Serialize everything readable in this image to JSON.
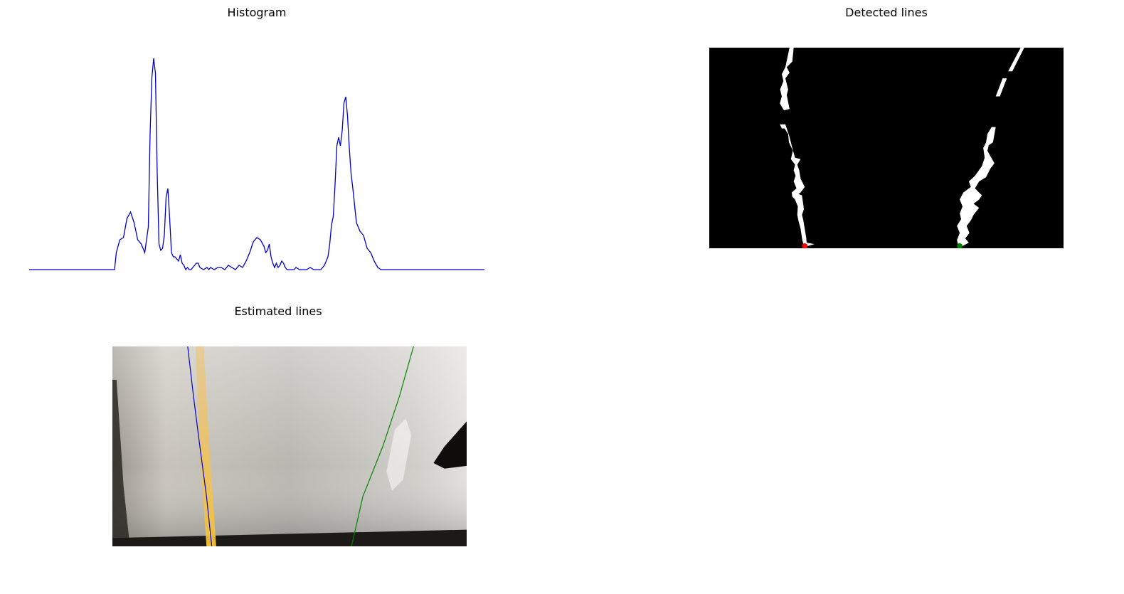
{
  "titles": {
    "histogram": "Histogram",
    "detected": "Detected lines",
    "estimated": "Estimated lines"
  },
  "colors": {
    "histogram_line": "#0000cc",
    "left_line": "#0000cc",
    "right_line": "#008000",
    "left_base_marker": "#ff0000",
    "right_base_marker": "#008000",
    "lane_pixels": "#ffffff",
    "detected_background": "#000000"
  },
  "chart_data": [
    {
      "type": "line",
      "title": "Histogram",
      "axes_visible": false,
      "xlim": [
        0,
        1280
      ],
      "ylim": [
        0,
        100
      ],
      "x": [
        0,
        240,
        245,
        255,
        265,
        275,
        285,
        295,
        305,
        315,
        325,
        335,
        340,
        345,
        350,
        355,
        360,
        365,
        370,
        375,
        380,
        385,
        390,
        395,
        400,
        405,
        410,
        420,
        425,
        430,
        435,
        440,
        445,
        450,
        455,
        460,
        465,
        470,
        475,
        480,
        490,
        500,
        505,
        510,
        520,
        530,
        540,
        550,
        560,
        570,
        580,
        590,
        600,
        610,
        620,
        630,
        640,
        650,
        660,
        665,
        670,
        675,
        680,
        685,
        690,
        695,
        700,
        705,
        710,
        715,
        720,
        725,
        730,
        735,
        740,
        745,
        750,
        760,
        770,
        780,
        790,
        800,
        820,
        830,
        835,
        840,
        845,
        850,
        855,
        860,
        865,
        870,
        875,
        880,
        885,
        890,
        895,
        900,
        905,
        910,
        915,
        920,
        925,
        930,
        940,
        950,
        960,
        970,
        980,
        990,
        1000,
        1010,
        1020,
        1280
      ],
      "y": [
        0,
        0,
        8,
        14,
        15,
        24,
        27,
        22,
        14,
        12,
        8,
        20,
        64,
        90,
        99,
        92,
        45,
        12,
        9,
        10,
        16,
        34,
        38,
        24,
        8,
        6,
        6,
        4,
        7,
        3,
        2,
        0,
        1,
        0,
        0,
        1,
        2,
        3,
        3,
        1,
        0,
        1,
        0,
        1,
        0,
        1,
        1,
        0,
        2,
        1,
        0,
        2,
        1,
        4,
        8,
        13,
        15,
        14,
        11,
        8,
        9,
        12,
        6,
        3,
        1,
        3,
        1,
        2,
        4,
        3,
        1,
        0,
        0,
        0,
        0,
        0,
        1,
        0,
        0,
        0,
        1,
        0,
        0,
        2,
        4,
        6,
        12,
        21,
        25,
        40,
        58,
        62,
        58,
        65,
        78,
        81,
        72,
        57,
        45,
        38,
        30,
        22,
        20,
        18,
        16,
        10,
        8,
        4,
        1,
        0,
        0,
        0,
        0,
        0
      ]
    },
    {
      "type": "scatter",
      "title": "Detected lines",
      "axes_visible": false,
      "xlim": [
        0,
        1280
      ],
      "ylim": [
        720,
        0
      ],
      "points": [
        {
          "series": "left base",
          "x": 345,
          "y": 712
        },
        {
          "series": "right base",
          "x": 905,
          "y": 712
        }
      ]
    },
    {
      "type": "line",
      "title": "Estimated lines",
      "axes_visible": false,
      "xlim": [
        0,
        1280
      ],
      "ylim": [
        720,
        0
      ],
      "series": [
        {
          "x": [
            272,
            293,
            316,
            340,
            359
          ],
          "y": [
            0,
            180,
            360,
            540,
            720
          ]
        },
        {
          "x": [
            1088,
            1037,
            977,
            905,
            864
          ],
          "y": [
            0,
            180,
            360,
            540,
            720
          ]
        }
      ]
    }
  ]
}
